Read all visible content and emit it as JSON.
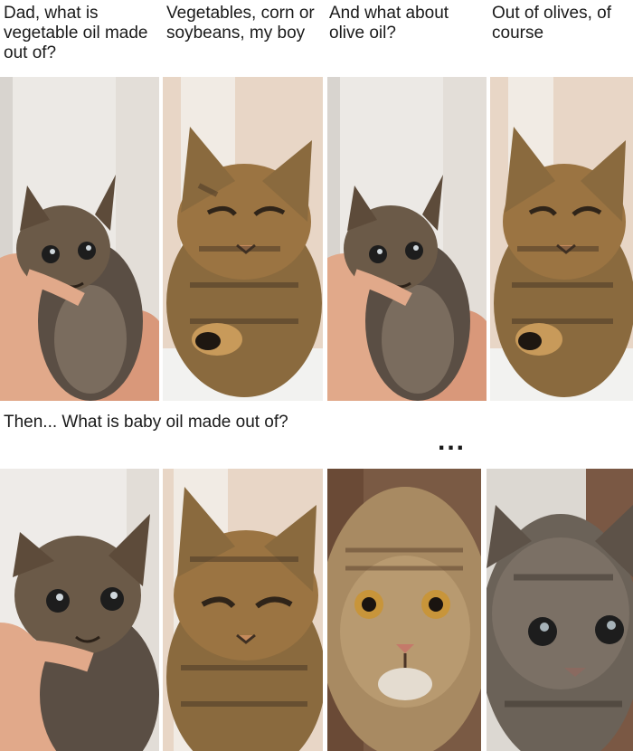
{
  "row1": {
    "captions": [
      "Dad, what is vegetable oil made out of?",
      "Vegetables, corn or soybeans, my boy",
      "And what about olive oil?",
      "Out of olives, of course"
    ]
  },
  "row2": {
    "caption": "Then... What is baby oil made out of?",
    "ellipsis": "..."
  },
  "panels": {
    "row1": [
      "kitten-held",
      "grumpy-cat",
      "kitten-held",
      "grumpy-cat"
    ],
    "row2": [
      "kitten-held-closeup",
      "grumpy-cat-closeup",
      "shocked-cat",
      "sad-kitten"
    ]
  },
  "colors": {
    "background": "#ffffff",
    "text": "#1a1a1a",
    "wall_light": "#e9e6e2",
    "wall_warm": "#e7d3c2",
    "skin": "#e1a98a",
    "tabby_brown": "#9b7442",
    "tabby_dark": "#3e2f22",
    "kitten_gray": "#6b6258"
  }
}
